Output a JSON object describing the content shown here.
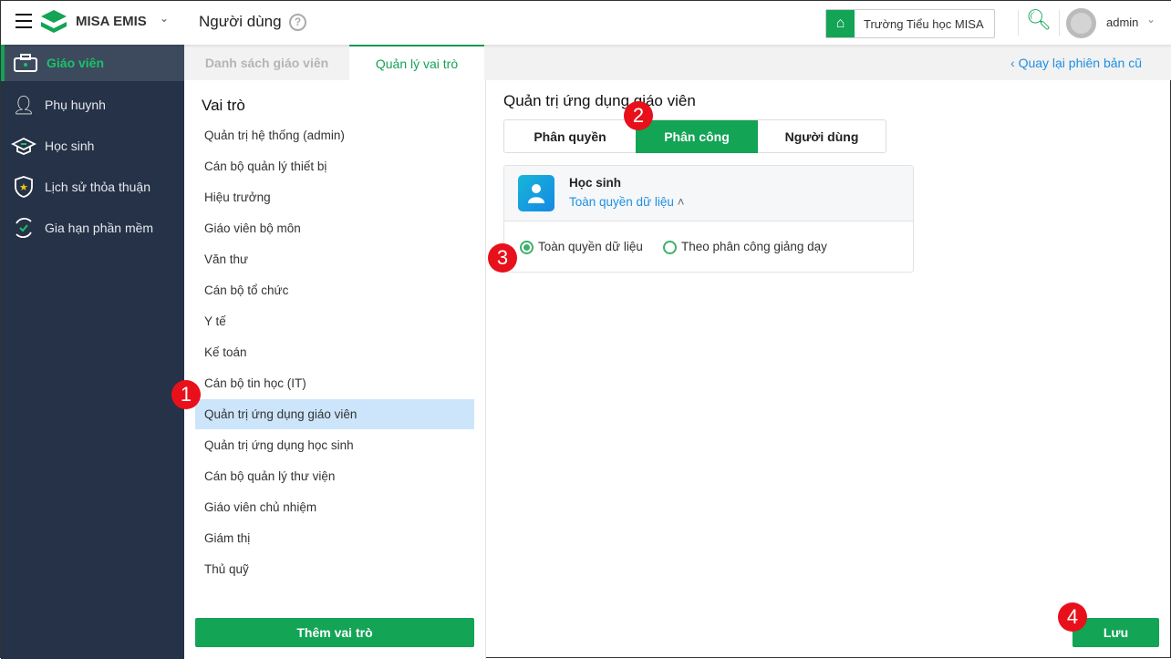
{
  "header": {
    "app_name": "MISA EMIS",
    "page_title": "Người dùng",
    "school": "Trường Tiểu học MISA",
    "user": "admin"
  },
  "sidebar": {
    "items": [
      {
        "label": "Giáo viên",
        "icon": "briefcase-icon",
        "active": true
      },
      {
        "label": "Phụ huynh",
        "icon": "parent-icon"
      },
      {
        "label": "Học sinh",
        "icon": "graduation-cap-icon"
      },
      {
        "label": "Lịch sử thỏa thuận",
        "icon": "shield-star-icon"
      },
      {
        "label": "Gia hạn phần mềm",
        "icon": "renew-icon"
      }
    ]
  },
  "tabs": [
    {
      "label": "Danh sách giáo viên"
    },
    {
      "label": "Quản lý vai trò",
      "active": true
    }
  ],
  "back_link": "Quay lại phiên bản cũ",
  "roles": {
    "title": "Vai trò",
    "items": [
      "Quản trị hệ thống (admin)",
      "Cán bộ quản lý thiết bị",
      "Hiệu trưởng",
      "Giáo viên bộ môn",
      "Văn thư",
      "Cán bộ tổ chức",
      "Y tế",
      "Kế toán",
      "Cán bộ tin học (IT)",
      "Quản trị ứng dụng giáo viên",
      "Quản trị ứng dụng học sinh",
      "Cán bộ quản lý thư viện",
      "Giáo viên chủ nhiệm",
      "Giám thị",
      "Thủ quỹ"
    ],
    "selected": 9,
    "add_button": "Thêm vai trò"
  },
  "detail": {
    "title": "Quản trị ứng dụng giáo viên",
    "segments": [
      "Phân quyền",
      "Phân công",
      "Người dùng"
    ],
    "active_segment": 1,
    "card": {
      "title": "Học sinh",
      "scope": "Toàn quyền dữ liệu",
      "options": [
        "Toàn quyền dữ liệu",
        "Theo phân công giảng dạy"
      ],
      "selected_option": 0
    },
    "save_button": "Lưu"
  },
  "badges": [
    "1",
    "2",
    "3",
    "4"
  ],
  "colors": {
    "accent": "#13a456",
    "sidebar": "#253247",
    "link": "#1e8fe1",
    "badge": "#e8101a"
  }
}
